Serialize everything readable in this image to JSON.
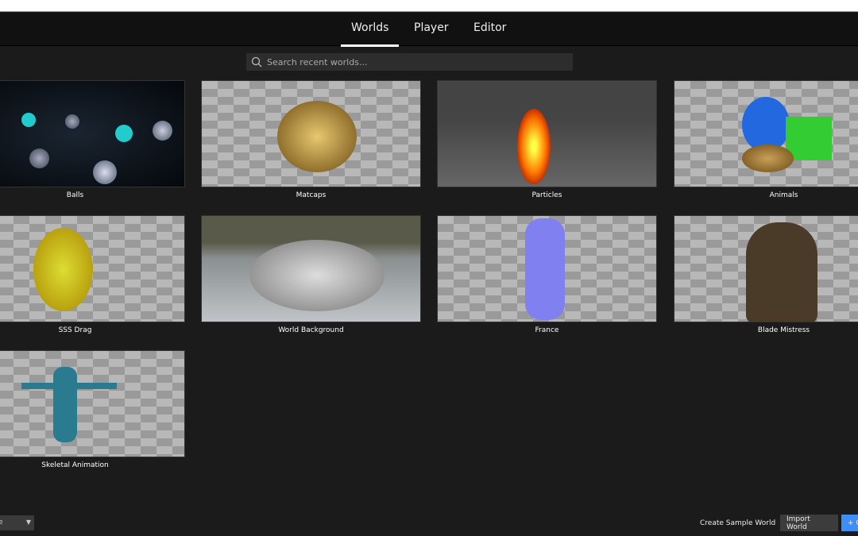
{
  "nav": {
    "tabs": [
      {
        "label": "Worlds",
        "active": true
      },
      {
        "label": "Player"
      },
      {
        "label": "Editor"
      }
    ]
  },
  "search": {
    "placeholder": "Search recent worlds..."
  },
  "worlds": [
    {
      "title": "Balls"
    },
    {
      "title": "Matcaps"
    },
    {
      "title": "Particles"
    },
    {
      "title": "Animals"
    },
    {
      "title": "SSS Drag"
    },
    {
      "title": "World Background"
    },
    {
      "title": "France"
    },
    {
      "title": "Blade Mistress"
    },
    {
      "title": "Skeletal Animation"
    }
  ],
  "footer": {
    "sort_value": "e",
    "create_sample": "Create Sample World",
    "import": "Import World",
    "create": "+ C"
  },
  "colors": {
    "accent": "#3d8ef5"
  }
}
